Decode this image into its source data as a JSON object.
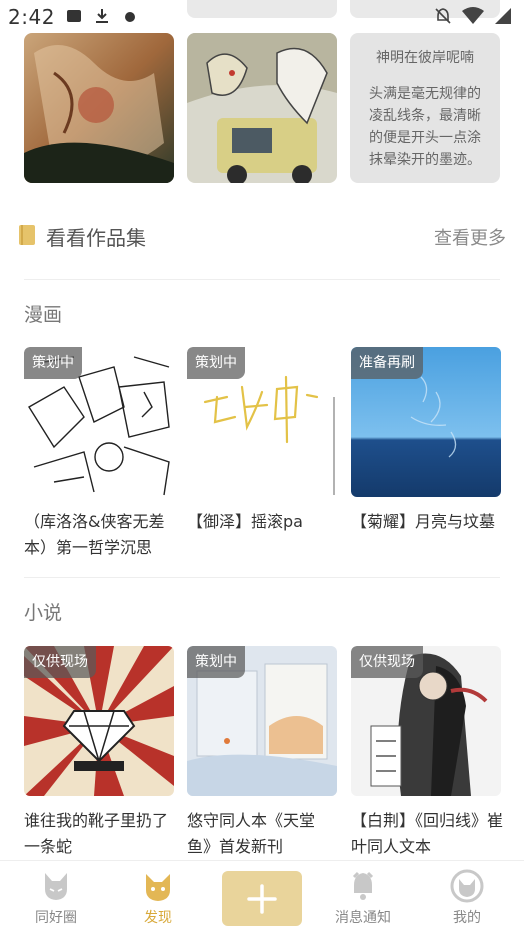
{
  "status_bar": {
    "time": "2:42"
  },
  "top_row": {
    "text_card": {
      "title": "神明在彼岸呢喃",
      "body": "头满是毫无规律的凌乱线条，最清晰的便是开头一点涂抹晕染开的墨迹。"
    }
  },
  "works": {
    "title": "看看作品集",
    "more_label": "查看更多",
    "manga": {
      "title": "漫画",
      "items": [
        {
          "badge": "策划中",
          "title": "（库洛洛&侠客无差本）第一哲学沉思"
        },
        {
          "badge": "策划中",
          "title": "【御泽】摇滚pa"
        },
        {
          "badge": "准备再刷",
          "title": "【菊耀】月亮与坟墓"
        }
      ]
    },
    "novel": {
      "title": "小说",
      "items": [
        {
          "badge": "仅供现场",
          "title": "谁往我的靴子里扔了一条蛇"
        },
        {
          "badge": "策划中",
          "title": "悠守同人本《天堂鱼》首发新刊"
        },
        {
          "badge": "仅供现场",
          "title": "【白荆】《回归线》崔叶同人文本"
        }
      ]
    }
  },
  "bottom_nav": {
    "items": [
      {
        "label": "同好圈",
        "icon": "fox-icon"
      },
      {
        "label": "发现",
        "icon": "fox-face-icon"
      },
      {
        "label": "消息通知",
        "icon": "bell-fox-icon"
      },
      {
        "label": "我的",
        "icon": "fox-avatar-icon"
      }
    ],
    "add_icon": "plus-icon"
  },
  "colors": {
    "accent": "#d8a93a",
    "add_button": "#e9d49b",
    "badge_bg": "#5a5a5a"
  }
}
